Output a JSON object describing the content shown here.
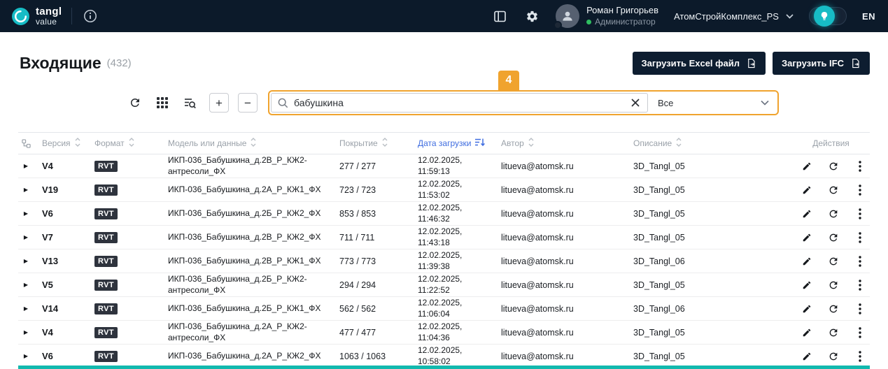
{
  "topbar": {
    "brand_top": "tangl",
    "brand_bottom": "value",
    "user_name": "Роман Григорьев",
    "user_role": "Администратор",
    "org": "АтомСтройКомплекс_PS",
    "lang": "EN"
  },
  "page": {
    "title": "Входящие",
    "count": "(432)",
    "upload_excel_label": "Загрузить Excel файл",
    "upload_ifc_label": "Загрузить IFC"
  },
  "toolbar": {
    "search_value": "бабушкина",
    "filter_value": "Все",
    "step_badge": "4"
  },
  "table": {
    "headers": {
      "version": "Версия",
      "format": "Формат",
      "model": "Модель или данные",
      "coverage": "Покрытие",
      "date": "Дата загрузки",
      "author": "Автор",
      "description": "Описание",
      "actions": "Действия"
    },
    "rows": [
      {
        "version": "V4",
        "format": "RVT",
        "model": "ИКП-036_Бабушкина_д.2В_Р_КЖ2-антресоли_ФХ",
        "coverage": "277 / 277",
        "date": "12.02.2025,",
        "time": "11:59:13",
        "author": "litueva@atomsk.ru",
        "description": "3D_Tangl_05"
      },
      {
        "version": "V19",
        "format": "RVT",
        "model": "ИКП-036_Бабушкина_д.2А_Р_КЖ1_ФХ",
        "coverage": "723 / 723",
        "date": "12.02.2025,",
        "time": "11:53:02",
        "author": "litueva@atomsk.ru",
        "description": "3D_Tangl_05"
      },
      {
        "version": "V6",
        "format": "RVT",
        "model": "ИКП-036_Бабушкина_д.2Б_Р_КЖ2_ФХ",
        "coverage": "853 / 853",
        "date": "12.02.2025,",
        "time": "11:46:32",
        "author": "litueva@atomsk.ru",
        "description": "3D_Tangl_05"
      },
      {
        "version": "V7",
        "format": "RVT",
        "model": "ИКП-036_Бабушкина_д.2В_Р_КЖ2_ФХ",
        "coverage": "711 / 711",
        "date": "12.02.2025,",
        "time": "11:43:18",
        "author": "litueva@atomsk.ru",
        "description": "3D_Tangl_05"
      },
      {
        "version": "V13",
        "format": "RVT",
        "model": "ИКП-036_Бабушкина_д.2В_Р_КЖ1_ФХ",
        "coverage": "773 / 773",
        "date": "12.02.2025,",
        "time": "11:39:38",
        "author": "litueva@atomsk.ru",
        "description": "3D_Tangl_06"
      },
      {
        "version": "V5",
        "format": "RVT",
        "model": "ИКП-036_Бабушкина_д.2Б_Р_КЖ2-антресоли_ФХ",
        "coverage": "294 / 294",
        "date": "12.02.2025,",
        "time": "11:22:52",
        "author": "litueva@atomsk.ru",
        "description": "3D_Tangl_05"
      },
      {
        "version": "V14",
        "format": "RVT",
        "model": "ИКП-036_Бабушкина_д.2Б_Р_КЖ1_ФХ",
        "coverage": "562 / 562",
        "date": "12.02.2025,",
        "time": "11:06:04",
        "author": "litueva@atomsk.ru",
        "description": "3D_Tangl_06"
      },
      {
        "version": "V4",
        "format": "RVT",
        "model": "ИКП-036_Бабушкина_д.2А_Р_КЖ2-антресоли_ФХ",
        "coverage": "477 / 477",
        "date": "12.02.2025,",
        "time": "11:04:36",
        "author": "litueva@atomsk.ru",
        "description": "3D_Tangl_05"
      },
      {
        "version": "V6",
        "format": "RVT",
        "model": "ИКП-036_Бабушкина_д.2А_Р_КЖ2_ФХ",
        "coverage": "1063 / 1063",
        "date": "12.02.2025,",
        "time": "10:58:02",
        "author": "litueva@atomsk.ru",
        "description": "3D_Tangl_05"
      }
    ]
  },
  "colors": {
    "accent_orange": "#F0A32E",
    "brand_teal": "#17BCC5",
    "topbar_bg": "#0C1A2A",
    "date_header_blue": "#3F6DE0",
    "status_green": "#2FBE60",
    "footer_teal": "#12B9AE"
  }
}
